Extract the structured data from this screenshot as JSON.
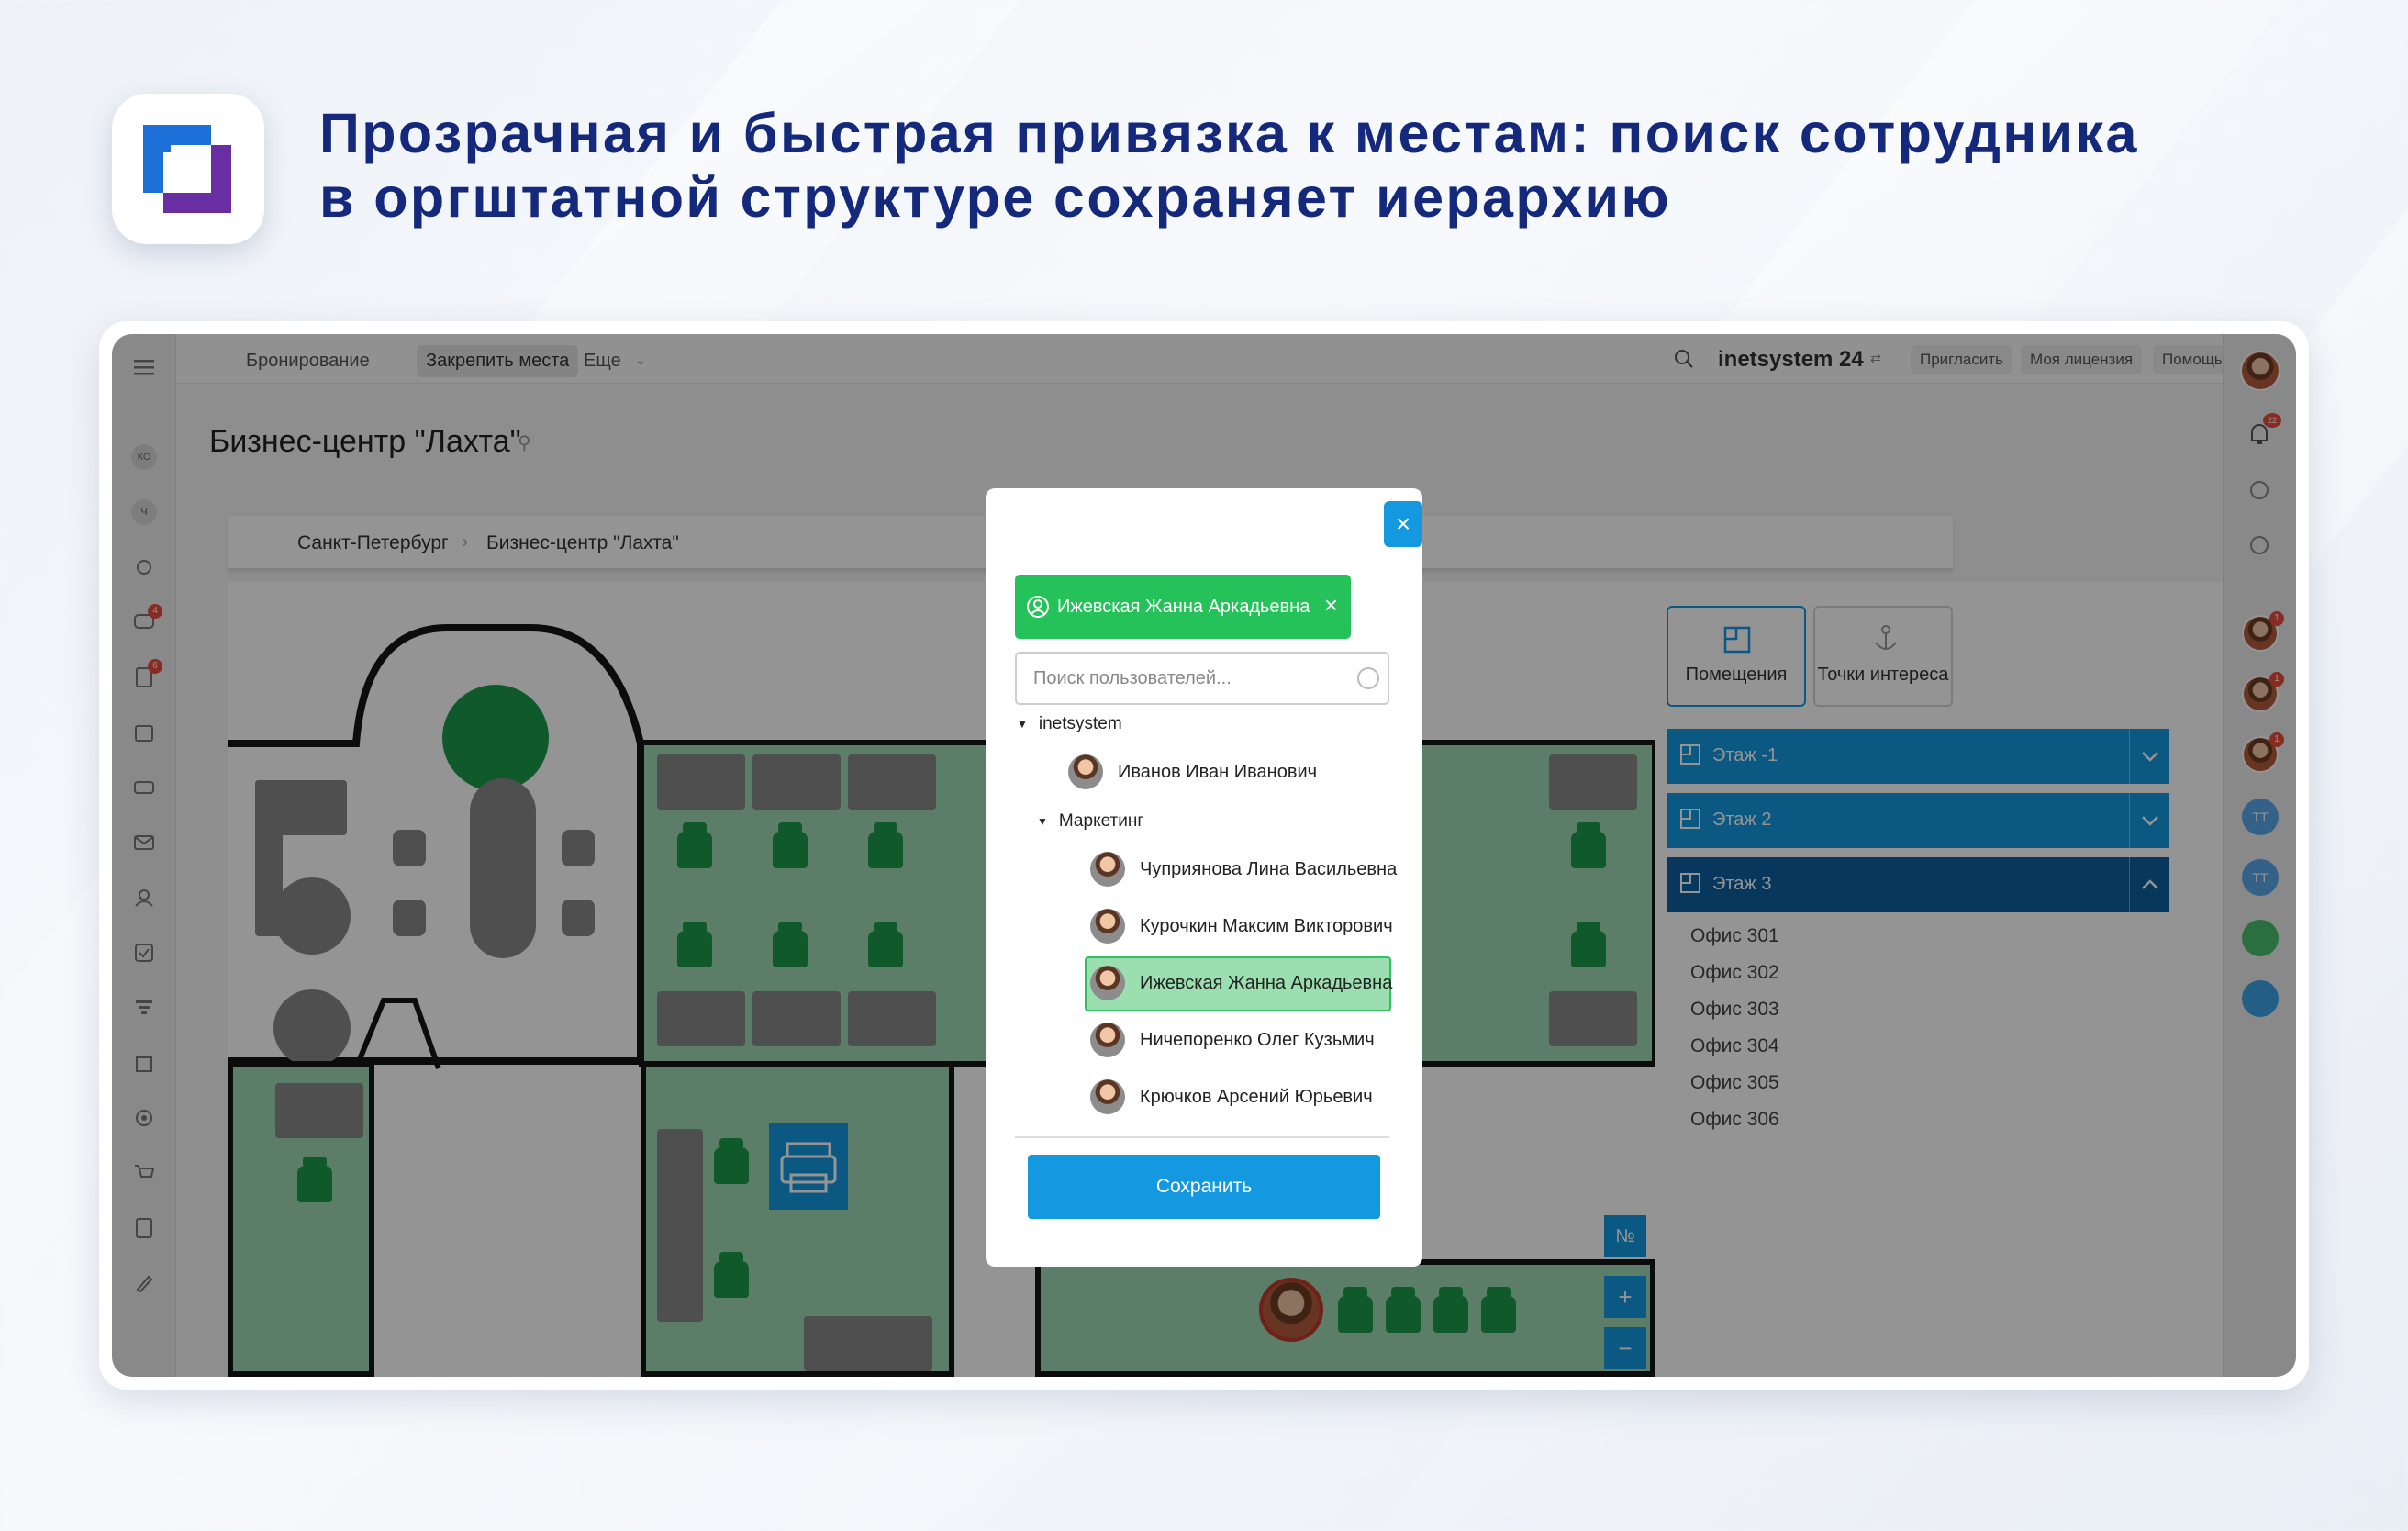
{
  "headline": {
    "line1": "Прозрачная и быстрая привязка к местам: поиск сотрудника",
    "line2": "в оргштатной структуре сохраняет иерархию"
  },
  "app": {
    "nav": {
      "booking": "Бронирование",
      "assign": "Закрепить места",
      "more": "Еще",
      "brand": "inetsystem 24",
      "invite": "Пригласить",
      "license": "Моя лицензия",
      "help": "Помощь"
    },
    "sidebar_badges": {
      "ko": "КО",
      "ch": "Ч",
      "b1": "4",
      "b2": "6"
    },
    "notifications_count": "22",
    "rightbar_badges": [
      "1",
      "1",
      "1"
    ],
    "rightbar_initials": [
      "ТТ",
      "ТТ"
    ],
    "page_title": "Бизнес-центр \"Лахта\"",
    "breadcrumb": {
      "city": "Санкт-Петербург",
      "place": "Бизнес-центр \"Лахта\""
    },
    "map_controls": {
      "number": "№",
      "zoom_in": "+",
      "zoom_out": "−"
    },
    "right_panel": {
      "tab_rooms": "Помещения",
      "tab_poi": "Точки интереса",
      "floors": [
        "Этаж -1",
        "Этаж 2",
        "Этаж 3"
      ],
      "offices": [
        "Офис 301",
        "Офис 302",
        "Офис 303",
        "Офис 304",
        "Офис 305",
        "Офис 306"
      ]
    }
  },
  "modal": {
    "close": "×",
    "selected_chip": "Ижевская Жанна Аркадьевна",
    "chip_remove": "×",
    "search_placeholder": "Поиск пользователей...",
    "org_root": "inetsystem",
    "root_user": "Иванов Иван Иванович",
    "department": "Маркетинг",
    "department_users": [
      "Чуприянова Лина Васильевна",
      "Курочкин Максим Викторович",
      "Ижевская Жанна Аркадьевна",
      "Ничепоренко Олег Кузьмич",
      "Крючков Арсений Юрьевич"
    ],
    "save": "Сохранить"
  },
  "colors": {
    "accent": "#1499e0",
    "headline": "#14297c",
    "selected": "#25c25a",
    "floor_active": "#0e5fa0"
  },
  "icons": [
    "menu-icon",
    "search-icon",
    "bell-icon",
    "close-icon",
    "user-icon",
    "chevron-down-icon",
    "chevron-up-icon",
    "floor-plan-icon",
    "pin-icon",
    "printer-icon"
  ]
}
